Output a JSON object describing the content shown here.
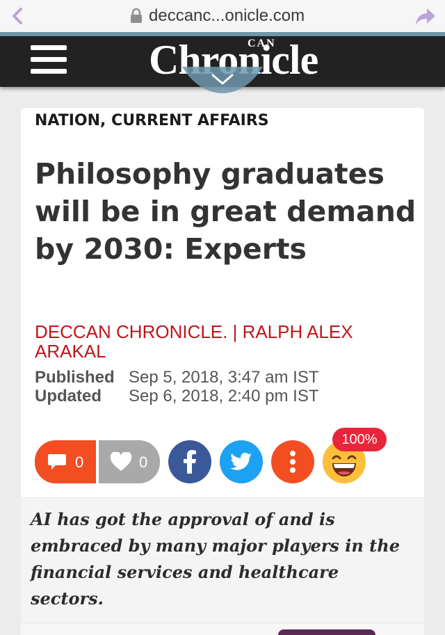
{
  "browser": {
    "url_display": "deccanc...onicle.com",
    "icons": [
      "back-chevron-icon",
      "lock-icon",
      "share-arrow-icon"
    ]
  },
  "header": {
    "logo_small": "CAN",
    "logo_text": "Chronicle",
    "menu_icon": "hamburger-icon",
    "pulldown_icon": "chevron-down-icon",
    "colors": {
      "bar": "#222222",
      "progress": "#6f97ad"
    }
  },
  "article": {
    "category": "NATION, CURRENT AFFAIRS",
    "headline": "Philosophy graduates will be in great demand by 2030: Experts",
    "byline": "DECCAN CHRONICLE. | RALPH ALEX ARAKAL",
    "published_label": "Published",
    "published_value": "Sep 5, 2018, 3:47 am IST",
    "updated_label": "Updated",
    "updated_value": "Sep 6, 2018, 2:40 pm IST",
    "summary": "AI has got the approval of and is embraced by many major players in the financial services and healthcare sectors."
  },
  "social": {
    "comment_count": "0",
    "like_count": "0",
    "reaction_percent": "100%",
    "icons": [
      "comment-icon",
      "heart-icon",
      "facebook-icon",
      "twitter-icon",
      "more-options-icon",
      "laughing-emoji-icon"
    ],
    "colors": {
      "comment": "#f34d22",
      "like": "#a9a9a9",
      "facebook": "#3b5998",
      "twitter": "#1da1f2",
      "more": "#f34d22",
      "badge": "#e8253a"
    }
  },
  "theme": {
    "byline_color": "#c0141b"
  }
}
